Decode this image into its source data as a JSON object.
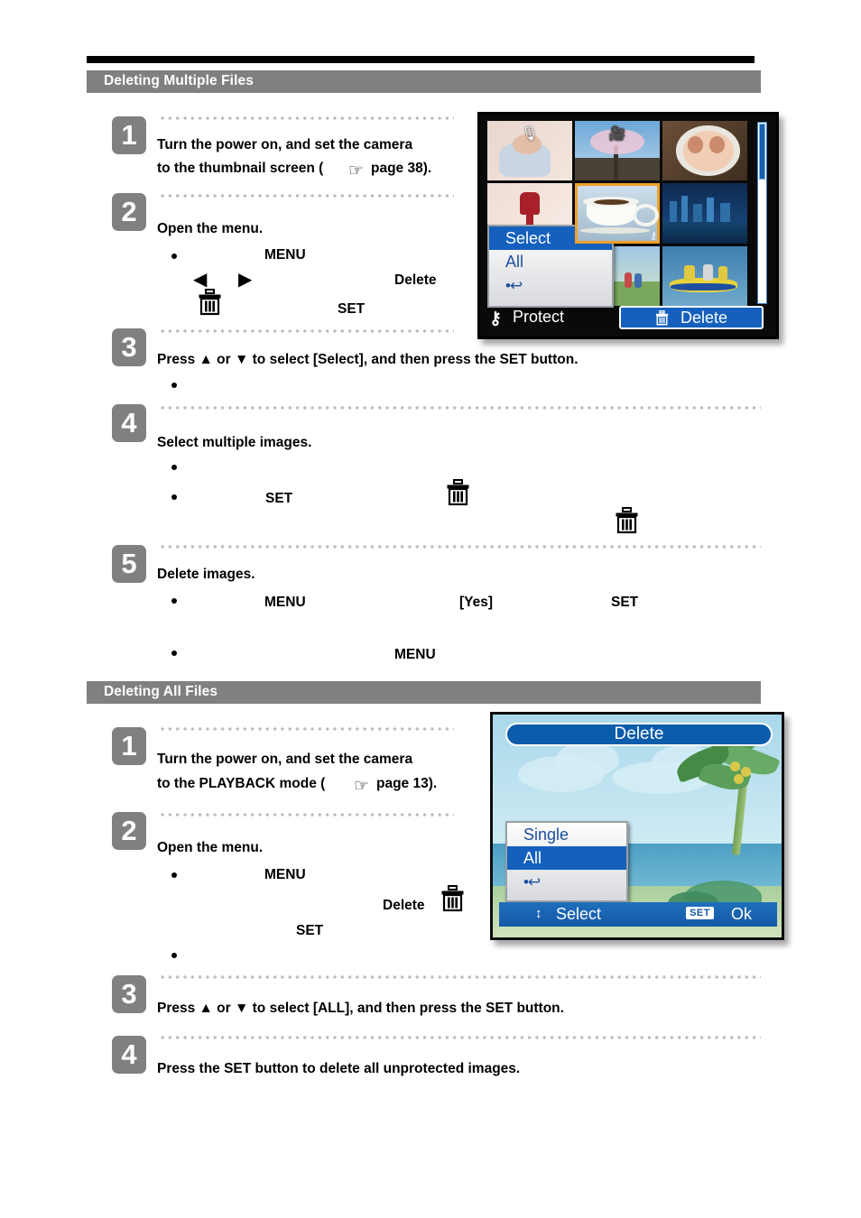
{
  "sections": [
    {
      "id": "deleting-multiple-files",
      "title": "Deleting Multiple Files",
      "steps": [
        {
          "number": "1",
          "lines": [
            "Turn the power on, and set the camera",
            "to the thumbnail screen (",
            "page 38)."
          ]
        },
        {
          "number": "2",
          "lines": [
            "Open the menu."
          ],
          "fragments": [
            "MENU",
            "Delete",
            "SET"
          ]
        },
        {
          "number": "3",
          "lines": [
            "Press ▲ or ▼ to select [Select], and then press the SET button."
          ]
        },
        {
          "number": "4",
          "lines": [
            "Select multiple images."
          ],
          "fragments": [
            "SET"
          ]
        },
        {
          "number": "5",
          "lines": [
            "Delete images."
          ],
          "fragments": [
            "MENU",
            "[Yes]",
            "SET",
            "MENU"
          ]
        }
      ]
    },
    {
      "id": "deleting-all-files",
      "title": "Deleting All Files",
      "steps": [
        {
          "number": "1",
          "lines": [
            "Turn the power on, and set the camera",
            "to the PLAYBACK mode (",
            "page 13)."
          ]
        },
        {
          "number": "2",
          "lines": [
            "Open the menu."
          ],
          "fragments": [
            "MENU",
            "Delete",
            "SET"
          ]
        },
        {
          "number": "3",
          "lines": [
            "Press ▲ or ▼ to select [ALL], and then press the SET button."
          ]
        },
        {
          "number": "4",
          "lines": [
            "Press the SET button to delete all unprotected images."
          ]
        }
      ]
    }
  ],
  "step_text": {
    "s1_line1": "Turn the power on, and set the camera",
    "s1_line2a": "to the thumbnail screen (",
    "s1_line2b": "page 38).",
    "s2_open": "Open the menu.",
    "s2_menu": "MENU",
    "s2_delete": "Delete",
    "s2_set": "SET",
    "s3_press": "Press ▲ or ▼ to select [Select], and then press the SET button.",
    "s4_select": "Select multiple images.",
    "s4_set": "SET",
    "s5_delete": "Delete images.",
    "s5_menu": "MENU",
    "s5_yes": "[Yes]",
    "s5_set": "SET",
    "s5_menu2": "MENU",
    "b1_line1": "Turn the power on, and set the camera",
    "b1_line2a": "to the PLAYBACK mode (",
    "b1_line2b": "page 13).",
    "b2_open": "Open the menu.",
    "b2_menu": "MENU",
    "b2_delete": "Delete",
    "b2_set": "SET",
    "b3_press": "Press ▲ or ▼ to select [ALL], and then press the SET button.",
    "b4_press": "Press the SET button to delete all unprotected images."
  },
  "numbers": {
    "n1": "1",
    "n2": "2",
    "n3": "3",
    "n4": "4",
    "n5": "5",
    "m1": "1",
    "m2": "2",
    "m3": "3",
    "m4": "4"
  },
  "glyphs": {
    "hand": "☞",
    "left_arrow": "◀",
    "right_arrow": "▶",
    "up_down": "↕"
  },
  "camera_screen_1": {
    "name": "thumbnail-delete-screen",
    "menu_items": [
      {
        "label": "Select",
        "selected": true
      },
      {
        "label": "All",
        "selected": false
      },
      {
        "label": "•↩",
        "selected": false
      }
    ],
    "bottom_bar": {
      "protect_label": "Protect",
      "protect_icon": "key-icon",
      "delete_label": "Delete",
      "delete_icon": "trash-icon"
    },
    "thumbnails": [
      {
        "caption": "baby-photo",
        "overlay_icon": "microphone-icon"
      },
      {
        "caption": "cherry-blossom-photo",
        "overlay_icon": "video-icon"
      },
      {
        "caption": "portrait-photo",
        "overlay_icon": ""
      },
      {
        "caption": "voice-memo",
        "overlay_icon": ""
      },
      {
        "caption": "coffee-cup-photo",
        "overlay_icon": "protect-key-icon"
      },
      {
        "caption": "city-skyline-photo",
        "overlay_icon": ""
      },
      {
        "caption": "family-outdoors-photo",
        "overlay_icon": ""
      },
      {
        "caption": "raft-photo",
        "overlay_icon": ""
      },
      {
        "caption": "dark-photo",
        "overlay_icon": ""
      }
    ],
    "scrollbar": {
      "position": "top"
    }
  },
  "camera_screen_2": {
    "name": "playback-delete-menu-screen",
    "title": "Delete",
    "menu_items": [
      {
        "label": "Single",
        "selected": false
      },
      {
        "label": "All",
        "selected": true
      },
      {
        "label": "•↩",
        "selected": false
      }
    ],
    "bottom_bar": {
      "select_label": "Select",
      "set_key_label": "SET",
      "ok_label": "Ok"
    }
  },
  "colors": {
    "band_gray": "#808080",
    "rule_black": "#000000",
    "badge_gray": "#808080",
    "menu_blue": "#1560bd",
    "menu_text_blue": "#1b4f9c",
    "dot_gray": "#bdbdbd",
    "selection_orange": "#f0a02a"
  }
}
